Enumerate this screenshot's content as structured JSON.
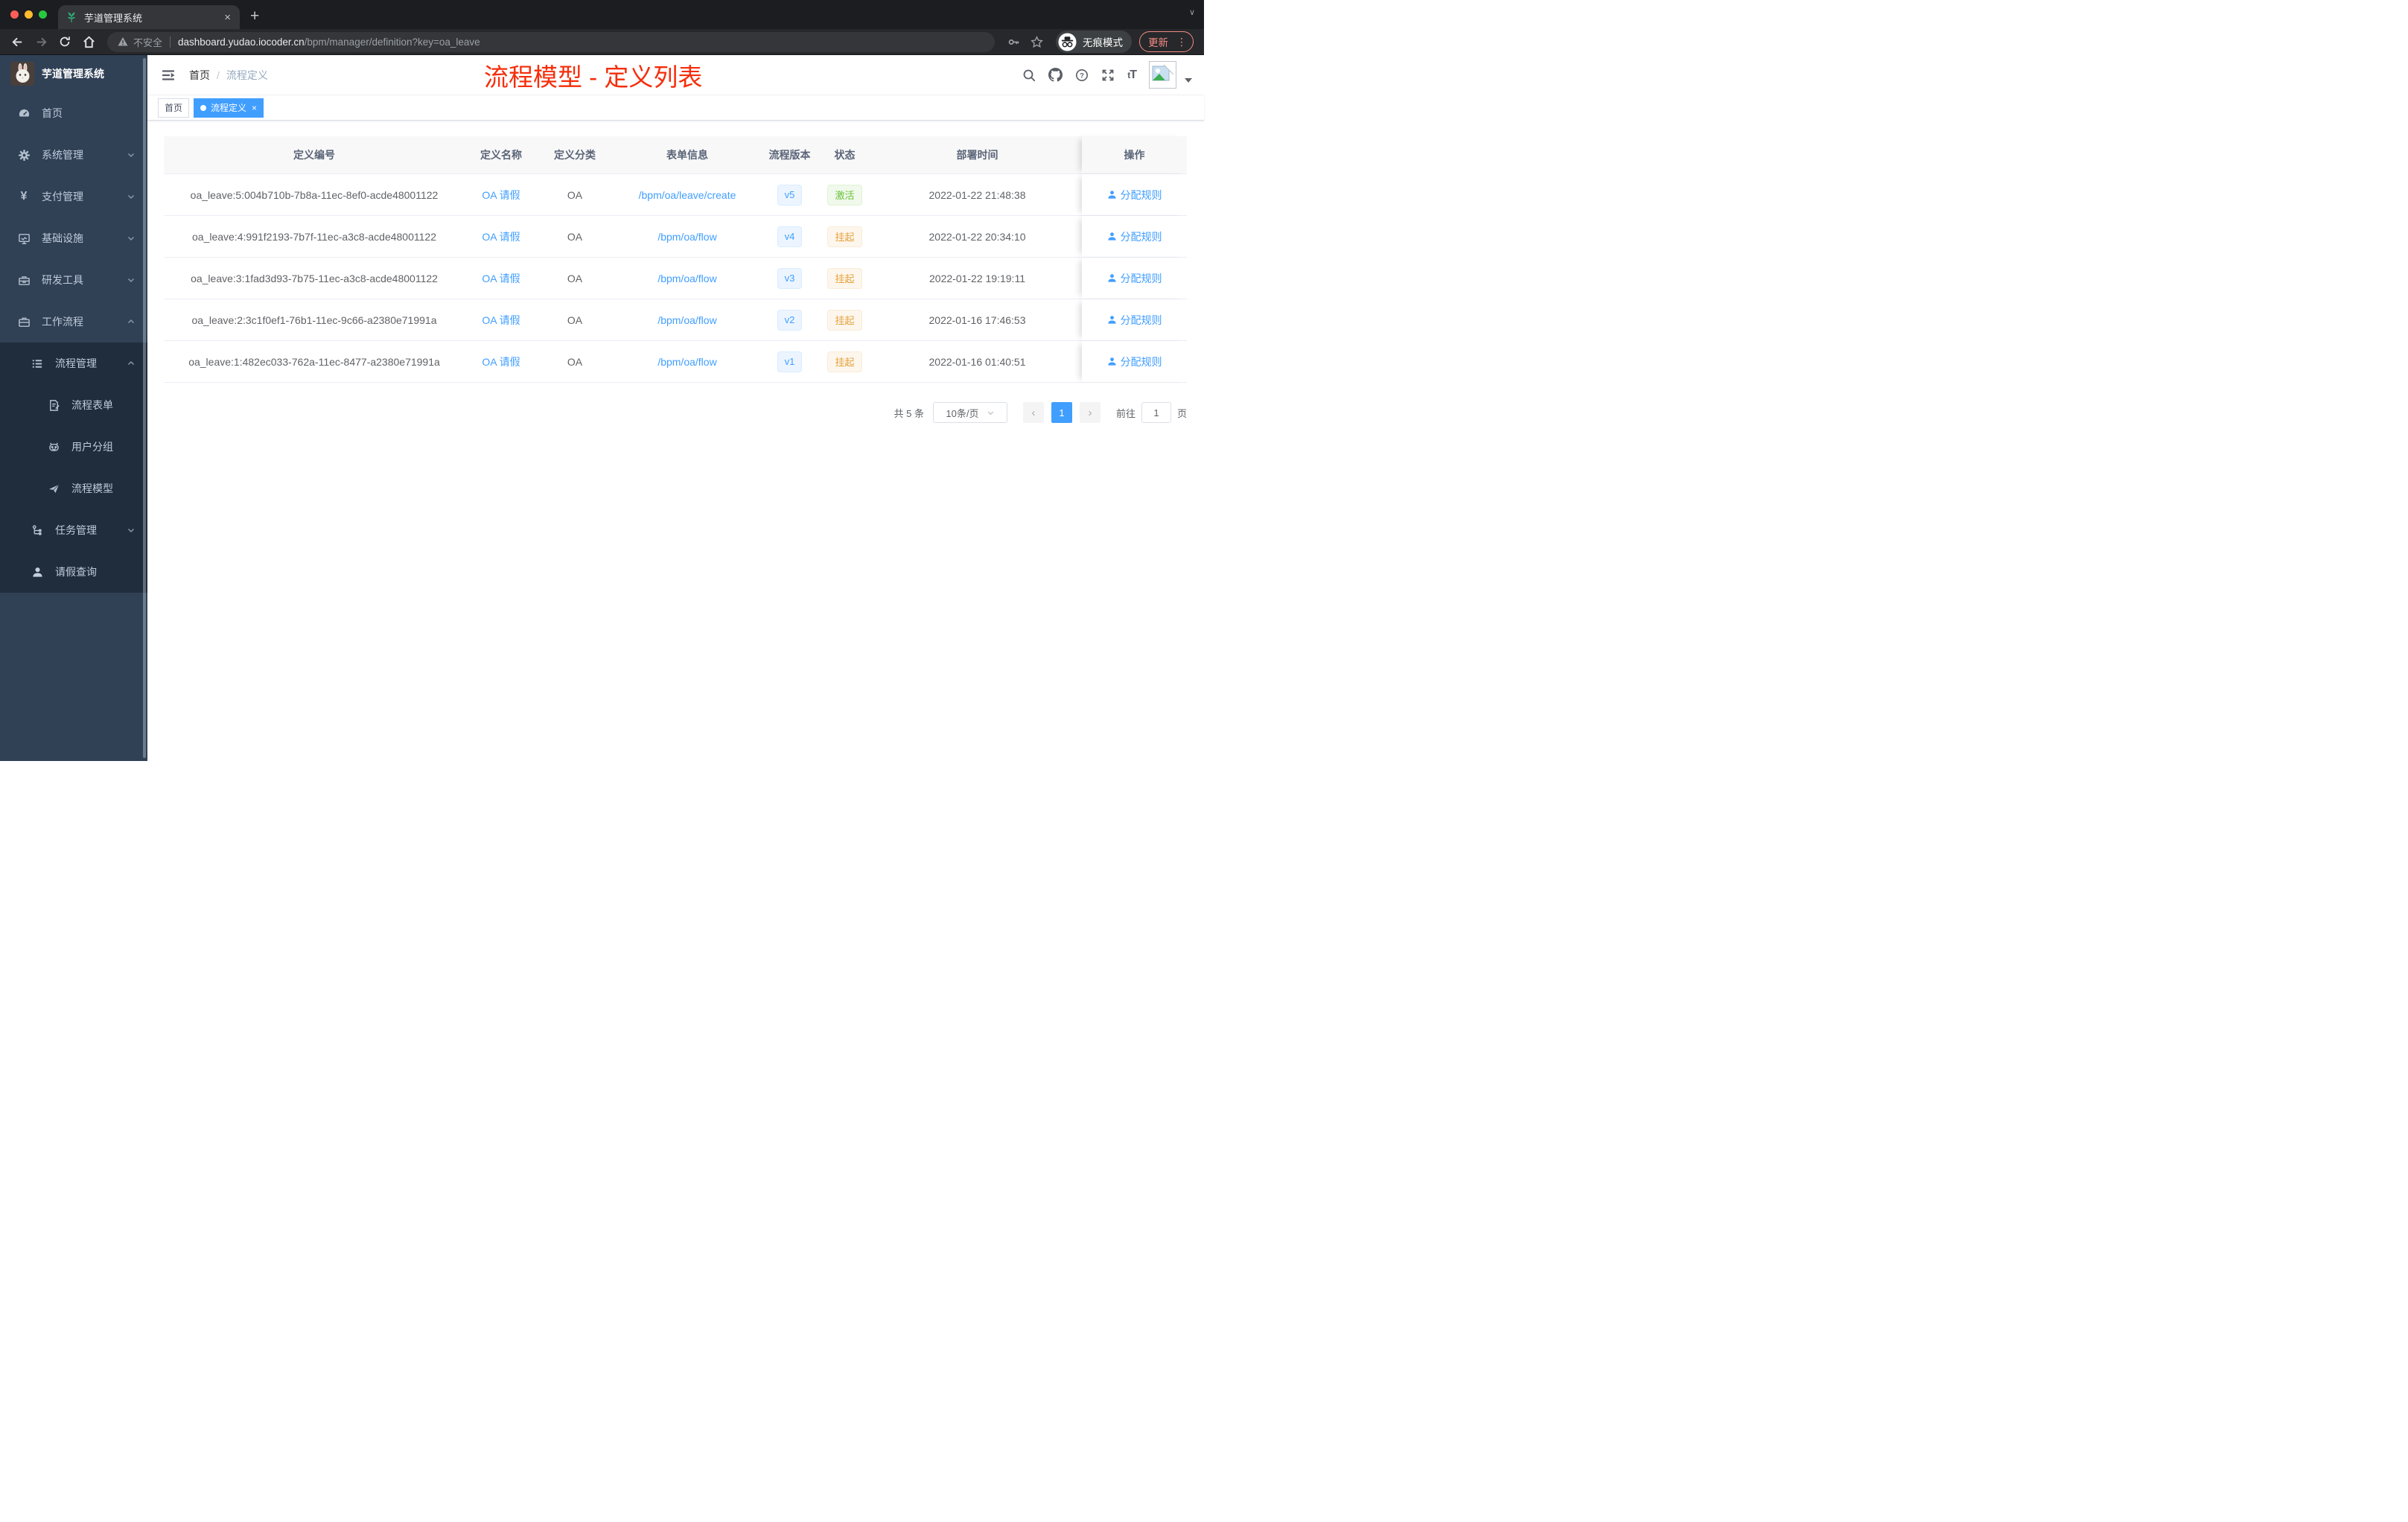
{
  "browser": {
    "tab": {
      "title": "芋道管理系统",
      "close": "×",
      "new_tab": "+"
    },
    "address": {
      "warning_label": "不安全",
      "url_host": "dashboard.yudao.iocoder.cn",
      "url_path": "/bpm/manager/definition?key=oa_leave"
    },
    "incognito_label": "无痕模式",
    "update_label": "更新",
    "update_dots": "⋮"
  },
  "sidebar": {
    "logo_title": "芋道管理系统",
    "menu": [
      {
        "label": "首页",
        "icon": "dashboard-icon"
      },
      {
        "label": "系统管理",
        "icon": "gear-icon",
        "arrow": "down"
      },
      {
        "label": "支付管理",
        "icon": "yen-icon",
        "arrow": "down"
      },
      {
        "label": "基础设施",
        "icon": "monitor-icon",
        "arrow": "down"
      },
      {
        "label": "研发工具",
        "icon": "toolbox-icon",
        "arrow": "down"
      },
      {
        "label": "工作流程",
        "icon": "briefcase-icon",
        "arrow": "up"
      },
      {
        "label": "流程管理",
        "icon": "list-icon",
        "arrow": "up"
      },
      {
        "label": "流程表单",
        "icon": "form-icon"
      },
      {
        "label": "用户分组",
        "icon": "robot-icon"
      },
      {
        "label": "流程模型",
        "icon": "send-icon"
      },
      {
        "label": "任务管理",
        "icon": "tree-icon",
        "arrow": "down"
      },
      {
        "label": "请假查询",
        "icon": "user-icon"
      }
    ]
  },
  "header": {
    "breadcrumb": {
      "home": "首页",
      "separator": "/",
      "current": "流程定义"
    },
    "annotation": "流程模型 - 定义列表"
  },
  "tags": [
    {
      "label": "首页"
    },
    {
      "label": "流程定义",
      "close": "×"
    }
  ],
  "table": {
    "columns": [
      "定义编号",
      "定义名称",
      "定义分类",
      "表单信息",
      "流程版本",
      "状态",
      "部署时间",
      "操作"
    ],
    "rows": [
      {
        "id": "oa_leave:5:004b710b-7b8a-11ec-8ef0-acde48001122",
        "name": "OA 请假",
        "category": "OA",
        "form": "/bpm/oa/leave/create",
        "version": "v5",
        "status": "激活",
        "status_type": "success",
        "time": "2022-01-22 21:48:38",
        "action": "分配规则"
      },
      {
        "id": "oa_leave:4:991f2193-7b7f-11ec-a3c8-acde48001122",
        "name": "OA 请假",
        "category": "OA",
        "form": "/bpm/oa/flow",
        "version": "v4",
        "status": "挂起",
        "status_type": "warning",
        "time": "2022-01-22 20:34:10",
        "action": "分配规则"
      },
      {
        "id": "oa_leave:3:1fad3d93-7b75-11ec-a3c8-acde48001122",
        "name": "OA 请假",
        "category": "OA",
        "form": "/bpm/oa/flow",
        "version": "v3",
        "status": "挂起",
        "status_type": "warning",
        "time": "2022-01-22 19:19:11",
        "action": "分配规则"
      },
      {
        "id": "oa_leave:2:3c1f0ef1-76b1-11ec-9c66-a2380e71991a",
        "name": "OA 请假",
        "category": "OA",
        "form": "/bpm/oa/flow",
        "version": "v2",
        "status": "挂起",
        "status_type": "warning",
        "time": "2022-01-16 17:46:53",
        "action": "分配规则"
      },
      {
        "id": "oa_leave:1:482ec033-762a-11ec-8477-a2380e71991a",
        "name": "OA 请假",
        "category": "OA",
        "form": "/bpm/oa/flow",
        "version": "v1",
        "status": "挂起",
        "status_type": "warning",
        "time": "2022-01-16 01:40:51",
        "action": "分配规则"
      }
    ]
  },
  "pagination": {
    "total": "共 5 条",
    "page_size": "10条/页",
    "prev": "‹",
    "current": "1",
    "next": "›",
    "goto": "前往",
    "goto_value": "1",
    "page_unit": "页"
  },
  "colors": {
    "accent": "#409eff",
    "annotation_red": "#f52d0a",
    "status_active": "#67c23a",
    "status_suspended": "#e6a23c",
    "sidebar_bg": "#304156",
    "submenu_bg": "#1f2d3d",
    "update_button": "#f28b82"
  }
}
